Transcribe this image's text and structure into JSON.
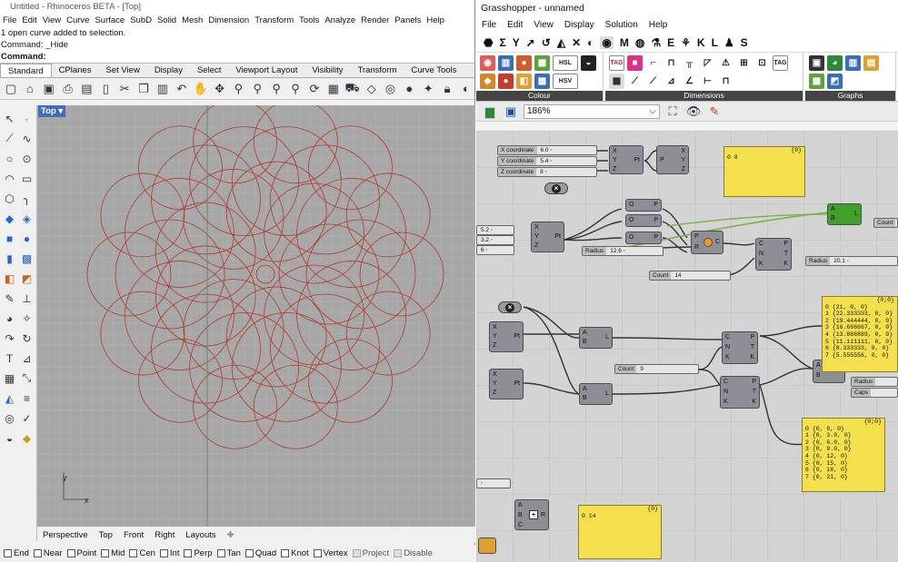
{
  "rhino": {
    "title": "Untitled - Rhinoceros BETA - [Top]",
    "menu": [
      "File",
      "Edit",
      "View",
      "Curve",
      "Surface",
      "SubD",
      "Solid",
      "Mesh",
      "Dimension",
      "Transform",
      "Tools",
      "Analyze",
      "Render",
      "Panels",
      "Help"
    ],
    "history": [
      "1 open curve added to selection.",
      "Command: _Hide"
    ],
    "command_prompt": "Command:",
    "tabs": [
      "Standard",
      "CPlanes",
      "Set View",
      "Display",
      "Select",
      "Viewport Layout",
      "Visibility",
      "Transform",
      "Curve Tools"
    ],
    "viewport_label": "Top",
    "axis_y": "y",
    "axis_x": "x",
    "view_tabs": [
      "Perspective",
      "Top",
      "Front",
      "Right",
      "Layouts"
    ],
    "osnaps": [
      "End",
      "Near",
      "Point",
      "Mid",
      "Cen",
      "Int",
      "Perp",
      "Tan",
      "Quad",
      "Knot",
      "Vertex",
      "Project",
      "Disable"
    ]
  },
  "grasshopper": {
    "title": "Grasshopper - unnamed",
    "menu": [
      "File",
      "Edit",
      "View",
      "Display",
      "Solution",
      "Help"
    ],
    "tab_letters": [
      "M",
      "E",
      "K",
      "L",
      "S"
    ],
    "panels": [
      "Colour",
      "Dimensions",
      "Graphs"
    ],
    "icon_labels": {
      "hsl": "HSL",
      "hsv": "HSV",
      "tag": "TAG"
    },
    "zoom": "186%",
    "sliders": {
      "x_coord": {
        "name": "X coordinate",
        "value": "6.0"
      },
      "y_coord": {
        "name": "Y coordinate",
        "value": "5.4"
      },
      "z_coord": {
        "name": "Z coordinate",
        "value": "8"
      },
      "v1": "5.2",
      "v2": "3.2",
      "v3": "6",
      "radius1": {
        "name": "Radius",
        "value": "12.6"
      },
      "count1": {
        "name": "Count",
        "value": "14"
      },
      "radius2": {
        "name": "Radius",
        "value": "20.1"
      },
      "count2": {
        "name": "Count",
        "value": "9"
      }
    },
    "small_labels": {
      "count": "Count",
      "radius": "Radius",
      "caps": "Caps"
    },
    "panel_top": {
      "header": "{0}",
      "rows": [
        "0  8"
      ]
    },
    "panel_mid": {
      "header": "{0;0}",
      "rows": [
        "0 {21, 0, 0}",
        "1 {22.333333, 0, 0}",
        "2 {19.444444, 0, 0}",
        "3 {16.666667, 0, 0}",
        "4 {13.888889, 0, 0}",
        "5 {11.111111, 0, 0}",
        "6 {8.333333, 0, 0}",
        "7 {5.555556, 0, 0}"
      ]
    },
    "panel_low": {
      "header": "{0;0}",
      "rows": [
        "0 {0, 0, 0}",
        "1 {0, 3.0, 0}",
        "2 {0, 6.0, 0}",
        "3 {0, 9.0, 0}",
        "4 {0, 12, 0}",
        "5 {0, 15, 0}",
        "6 {0, 18, 0}",
        "7 {0, 21, 0}"
      ]
    },
    "panel_bottom": {
      "header": "{0}",
      "rows": [
        "0  14"
      ]
    },
    "ports": {
      "xyz": [
        "X",
        "Y",
        "Z"
      ],
      "pt": "Pt",
      "p": "P",
      "c": "C",
      "r": "R",
      "ab": [
        "A",
        "B"
      ],
      "cnk": [
        "C",
        "N",
        "K"
      ],
      "ptk": [
        "P",
        "T",
        "K"
      ],
      "l": "L",
      "cnrb": [
        "A",
        "B",
        "C"
      ]
    }
  }
}
